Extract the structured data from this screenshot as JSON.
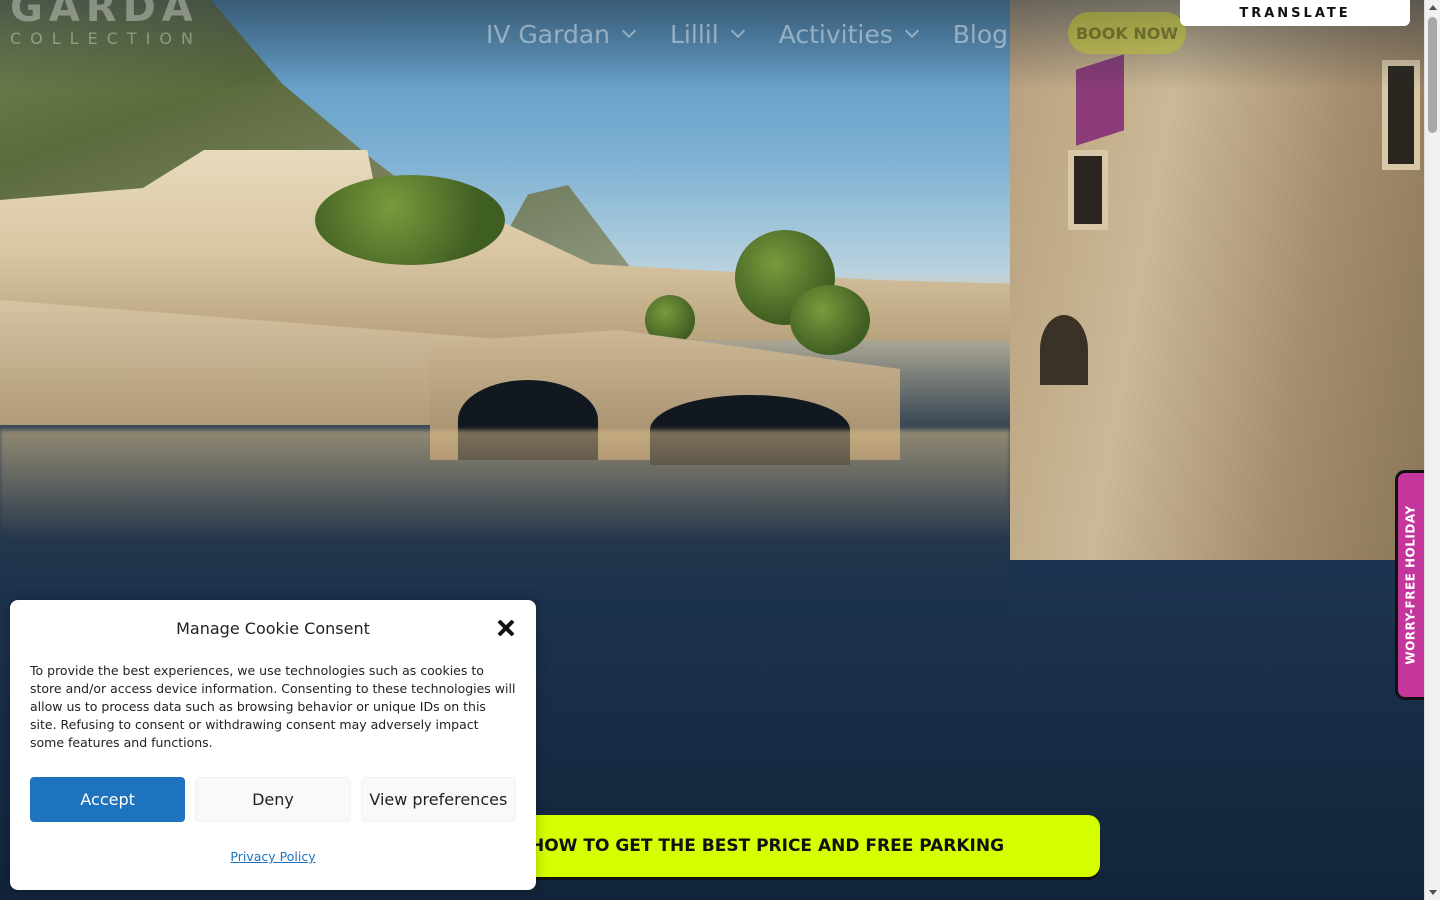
{
  "header": {
    "logo": {
      "main": "GARDA",
      "sub": "COLLECTION"
    },
    "nav": [
      {
        "label": "IV Gardan"
      },
      {
        "label": "Lillil"
      },
      {
        "label": "Activities"
      },
      {
        "label": "Blog"
      }
    ],
    "book_label": "BOOK NOW",
    "translate_label": "TRANSLATE"
  },
  "side_tab": {
    "label": "WORRY-FREE HOLIDAY"
  },
  "promo": {
    "label": "HOW TO GET THE BEST PRICE AND FREE PARKING"
  },
  "cookie": {
    "title": "Manage Cookie Consent",
    "body": "To provide the best experiences, we use technologies such as cookies to store and/or access device information. Consenting to these technologies will allow us to process data such as browsing behavior or unique IDs on this site. Refusing to consent or withdrawing consent may adversely impact some features and functions.",
    "accept_label": "Accept",
    "deny_label": "Deny",
    "preferences_label": "View preferences",
    "policy_label": "Privacy Policy"
  },
  "colors": {
    "accent_lime": "#d4ff00",
    "accept_blue": "#1e73be",
    "side_tab_pink": "#c4369c"
  }
}
